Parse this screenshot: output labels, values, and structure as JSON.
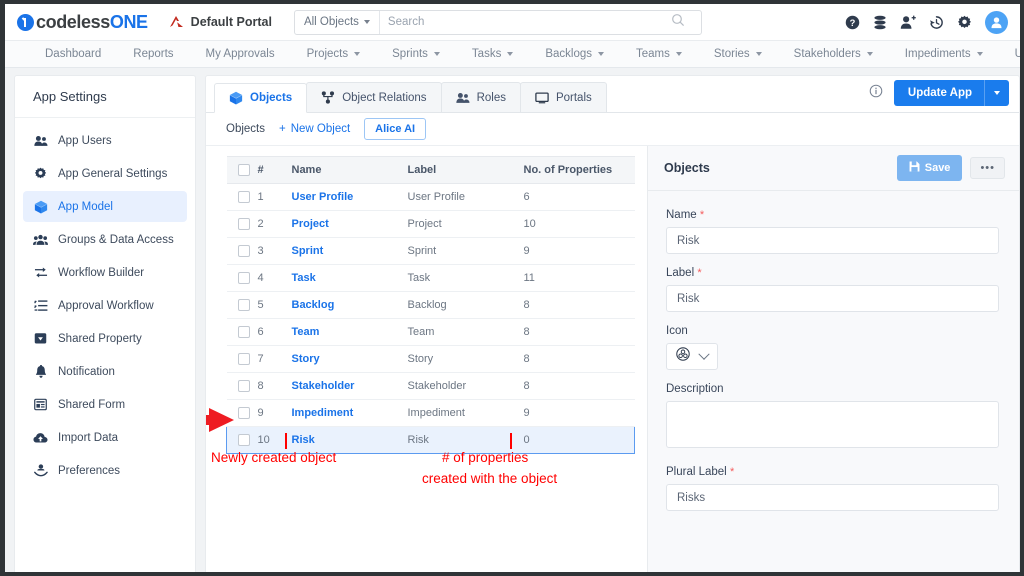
{
  "brand": {
    "codeless": "codeless",
    "one": "ONE"
  },
  "topbar": {
    "portal_name": "Default Portal",
    "scope_label": "All Objects",
    "search_placeholder": "Search",
    "search_value": "",
    "icons": [
      "help-icon",
      "database-icon",
      "add-user-icon",
      "history-icon",
      "gear-icon",
      "avatar"
    ]
  },
  "nav": {
    "items": [
      {
        "label": "Dashboard",
        "caret": false
      },
      {
        "label": "Reports",
        "caret": false
      },
      {
        "label": "My Approvals",
        "caret": false
      },
      {
        "label": "Projects",
        "caret": true
      },
      {
        "label": "Sprints",
        "caret": true
      },
      {
        "label": "Tasks",
        "caret": true
      },
      {
        "label": "Backlogs",
        "caret": true
      },
      {
        "label": "Teams",
        "caret": true
      },
      {
        "label": "Stories",
        "caret": true
      },
      {
        "label": "Stakeholders",
        "caret": true
      },
      {
        "label": "Impediments",
        "caret": true
      },
      {
        "label": "User Profiles",
        "caret": true
      }
    ]
  },
  "sidebar": {
    "title": "App Settings",
    "items": [
      {
        "label": "App Users",
        "icon": "users-icon",
        "active": false
      },
      {
        "label": "App General Settings",
        "icon": "gear-icon",
        "active": false
      },
      {
        "label": "App Model",
        "icon": "cube-icon",
        "active": true
      },
      {
        "label": "Groups & Data Access",
        "icon": "group-icon",
        "active": false
      },
      {
        "label": "Workflow Builder",
        "icon": "arrows-icon",
        "active": false
      },
      {
        "label": "Approval Workflow",
        "icon": "checklist-icon",
        "active": false
      },
      {
        "label": "Shared Property",
        "icon": "tag-icon",
        "active": false
      },
      {
        "label": "Notification",
        "icon": "bell-icon",
        "active": false
      },
      {
        "label": "Shared Form",
        "icon": "form-icon",
        "active": false
      },
      {
        "label": "Import Data",
        "icon": "cloud-upload-icon",
        "active": false
      },
      {
        "label": "Preferences",
        "icon": "preferences-icon",
        "active": false
      }
    ]
  },
  "main": {
    "tabs": [
      {
        "label": "Objects",
        "icon": "cube-icon",
        "active": true
      },
      {
        "label": "Object Relations",
        "icon": "relations-icon",
        "active": false
      },
      {
        "label": "Roles",
        "icon": "users-icon",
        "active": false
      },
      {
        "label": "Portals",
        "icon": "screen-icon",
        "active": false
      }
    ],
    "info_icon": "info-icon",
    "update_button": "Update App",
    "sub_toolbar": {
      "label": "Objects",
      "new_object": "New Object",
      "alice": "Alice AI"
    },
    "table": {
      "columns": [
        "",
        "#",
        "Name",
        "Label",
        "No. of Properties"
      ],
      "rows": [
        {
          "num": "1",
          "name": "User Profile",
          "label": "User Profile",
          "props": "6",
          "highlight": false
        },
        {
          "num": "2",
          "name": "Project",
          "label": "Project",
          "props": "10",
          "highlight": false
        },
        {
          "num": "3",
          "name": "Sprint",
          "label": "Sprint",
          "props": "9",
          "highlight": false
        },
        {
          "num": "4",
          "name": "Task",
          "label": "Task",
          "props": "11",
          "highlight": false
        },
        {
          "num": "5",
          "name": "Backlog",
          "label": "Backlog",
          "props": "8",
          "highlight": false
        },
        {
          "num": "6",
          "name": "Team",
          "label": "Team",
          "props": "8",
          "highlight": false
        },
        {
          "num": "7",
          "name": "Story",
          "label": "Story",
          "props": "8",
          "highlight": false
        },
        {
          "num": "8",
          "name": "Stakeholder",
          "label": "Stakeholder",
          "props": "8",
          "highlight": false
        },
        {
          "num": "9",
          "name": "Impediment",
          "label": "Impediment",
          "props": "9",
          "highlight": false
        },
        {
          "num": "10",
          "name": "Risk",
          "label": "Risk",
          "props": "0",
          "highlight": true
        }
      ]
    }
  },
  "properties_panel": {
    "title": "Objects",
    "save_label": "Save",
    "more_label": "•••",
    "fields": {
      "name": {
        "label": "Name",
        "required": true,
        "value": "Risk"
      },
      "label": {
        "label": "Label",
        "required": true,
        "value": "Risk"
      },
      "icon": {
        "label": "Icon",
        "required": false,
        "value": "biohazard-icon"
      },
      "description": {
        "label": "Description",
        "required": false,
        "value": ""
      },
      "plural_label": {
        "label": "Plural Label",
        "required": true,
        "value": "Risks"
      }
    }
  },
  "annotations": [
    {
      "text": "Newly created object"
    },
    {
      "text": "# of properties"
    },
    {
      "text": "created with the object"
    }
  ],
  "colors": {
    "accent_blue": "#1a73e8",
    "annotation_red": "#ff0000",
    "highlight_row": "#eaf2fd",
    "panel_bg": "#f8f9fb"
  }
}
